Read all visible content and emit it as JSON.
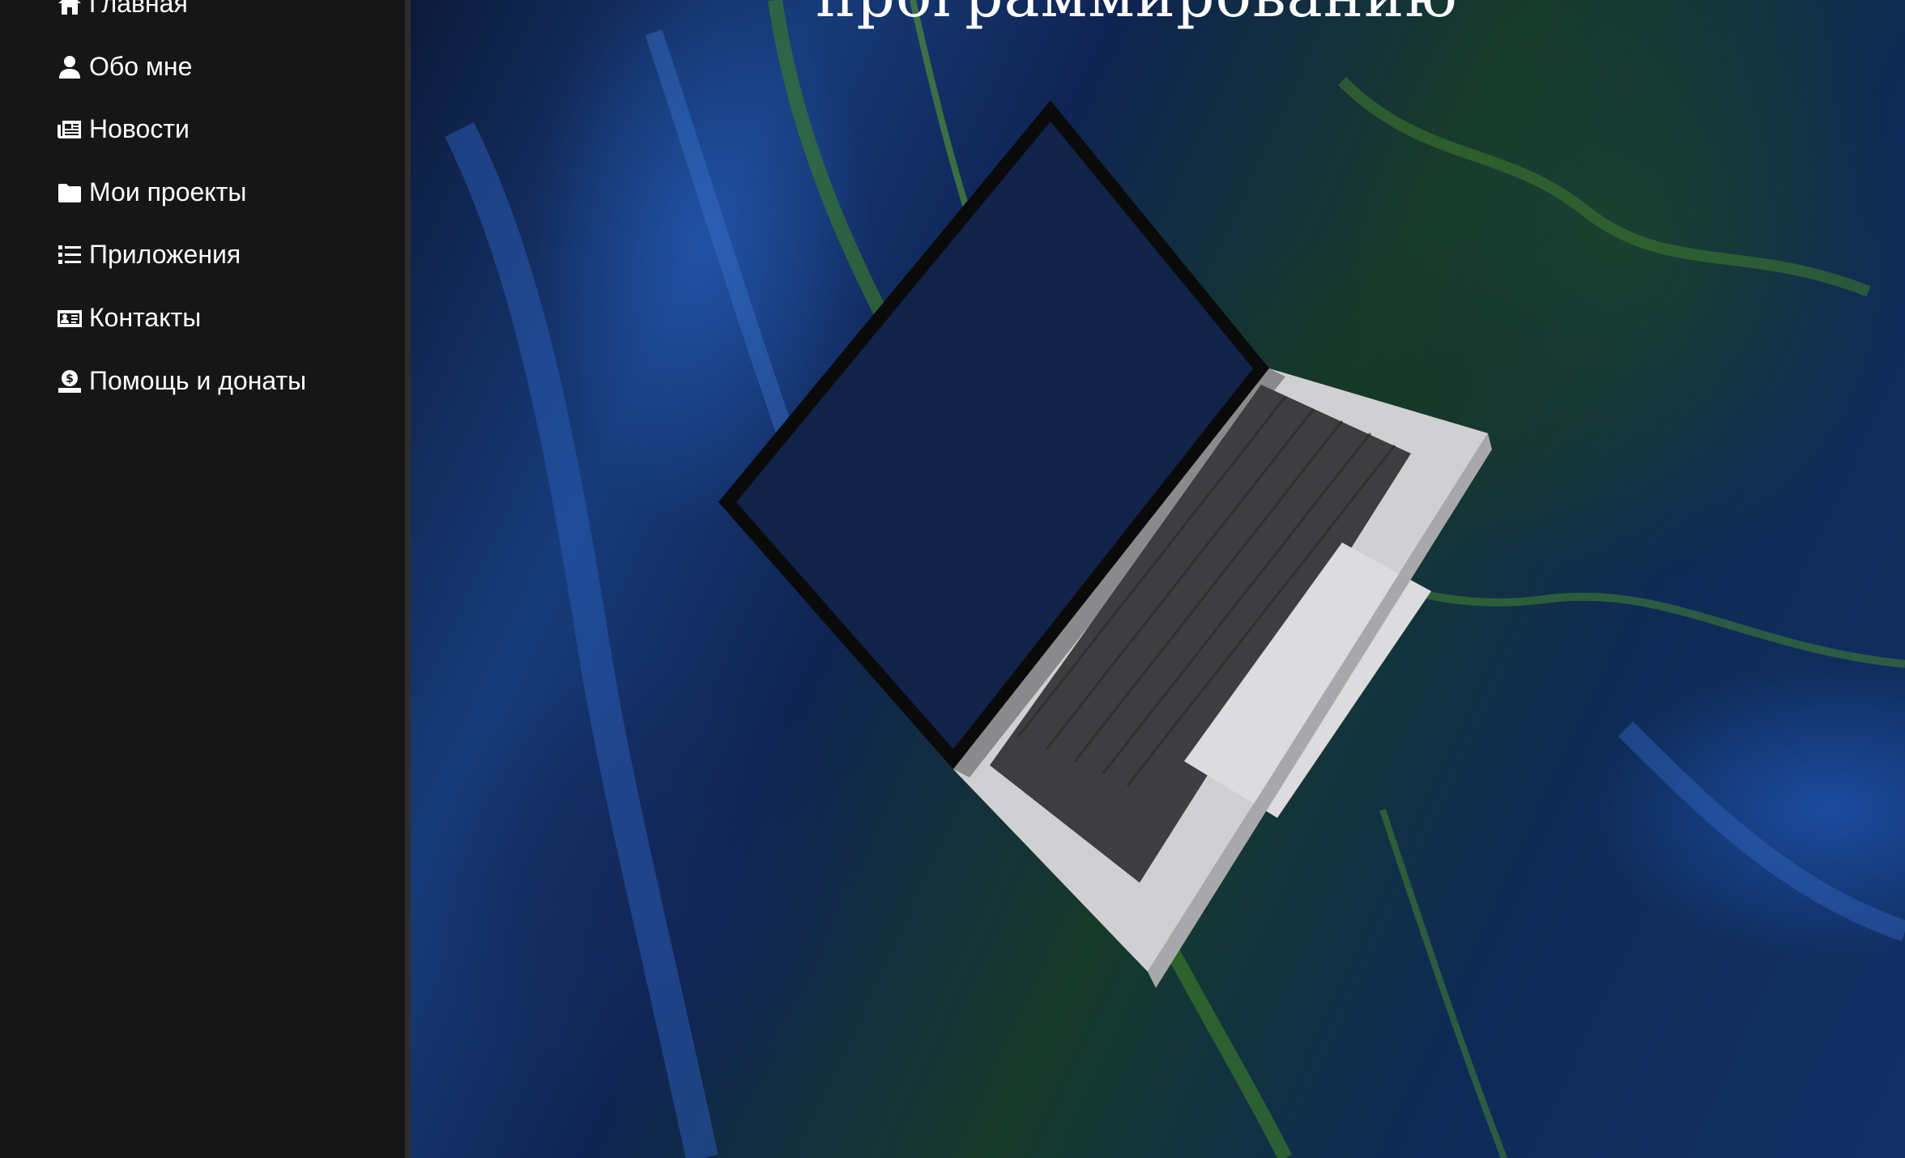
{
  "sidebar": {
    "items": [
      {
        "label": "Главная",
        "icon": "home-icon"
      },
      {
        "label": "Обо мне",
        "icon": "user-icon"
      },
      {
        "label": "Новости",
        "icon": "newspaper-icon"
      },
      {
        "label": "Мои проекты",
        "icon": "folder-icon"
      },
      {
        "label": "Приложения",
        "icon": "list-icon"
      },
      {
        "label": "Контакты",
        "icon": "id-card-icon"
      },
      {
        "label": "Помощь и донаты",
        "icon": "donate-icon"
      }
    ]
  },
  "hero": {
    "title": "программированию"
  },
  "colors": {
    "sidebar_bg": "#161616",
    "text": "#ffffff"
  }
}
